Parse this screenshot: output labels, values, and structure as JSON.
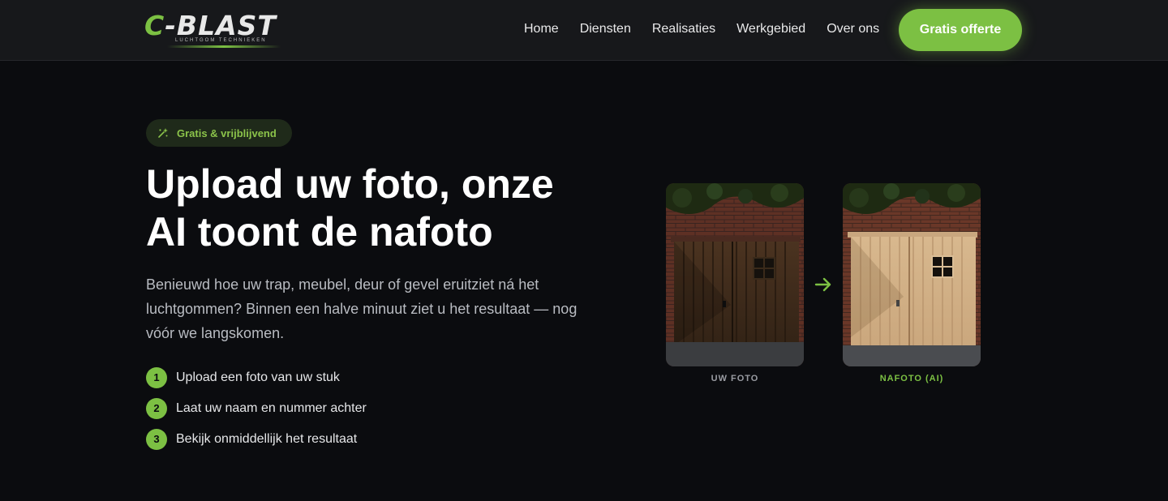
{
  "brand": {
    "name": "C-BLAST",
    "tagline": "LUCHTGOM TECHNIEKEN",
    "accent_color": "#7cc043"
  },
  "nav": {
    "links": [
      "Home",
      "Diensten",
      "Realisaties",
      "Werkgebied",
      "Over ons"
    ],
    "cta": "Gratis offerte"
  },
  "hero": {
    "badge": "Gratis & vrijblijvend",
    "badge_icon": "sparkles-icon",
    "title_line1": "Upload uw foto, onze",
    "title_line2": "AI toont de nafoto",
    "description": "Benieuwd hoe uw trap, meubel, deur of gevel eruitziet ná het luchtgommen? Binnen een halve minuut ziet u het resultaat — nog vóór we langskomen.",
    "steps": [
      {
        "number": "1",
        "text": "Upload een foto van uw stuk"
      },
      {
        "number": "2",
        "text": "Laat uw naam en nummer achter"
      },
      {
        "number": "3",
        "text": "Bekijk onmiddellijk het resultaat"
      }
    ]
  },
  "comparison": {
    "before_caption": "UW FOTO",
    "after_caption": "NAFOTO (AI)",
    "arrow_icon": "arrow-right-icon"
  }
}
